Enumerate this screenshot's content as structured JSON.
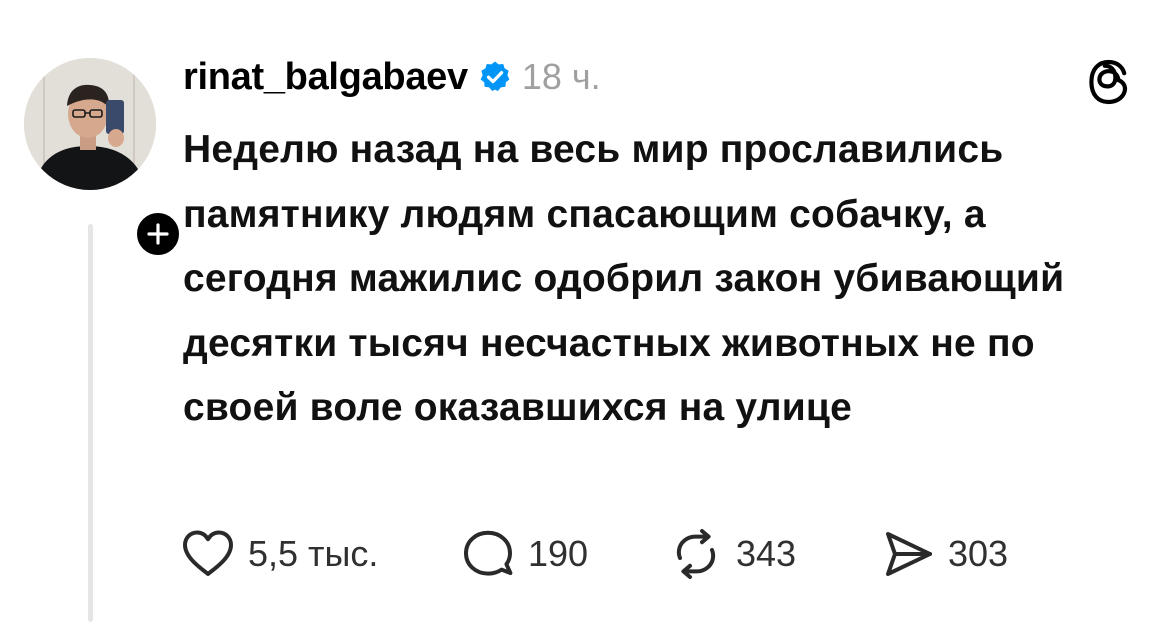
{
  "post": {
    "username": "rinat_balgabaev",
    "time": "18 ч.",
    "body": "Неделю назад на весь мир прославились памятнику людям спасающим собачку, а сегодня мажилис одобрил закон убивающий десятки тысяч несчастных животных не по своей воле оказавшихся на улице",
    "verified": true
  },
  "actions": {
    "likes": "5,5 тыс.",
    "comments": "190",
    "reposts": "343",
    "shares": "303"
  },
  "icons": {
    "verified": "verified-check-icon",
    "follow": "plus-icon",
    "app": "threads-logo-icon",
    "like": "heart-icon",
    "comment": "speech-bubble-icon",
    "repost": "repost-arrows-icon",
    "share": "send-icon"
  },
  "colors": {
    "verified_blue": "#0095f6",
    "muted_text": "#a0a0a0",
    "thread_line": "#e6e6e6"
  }
}
